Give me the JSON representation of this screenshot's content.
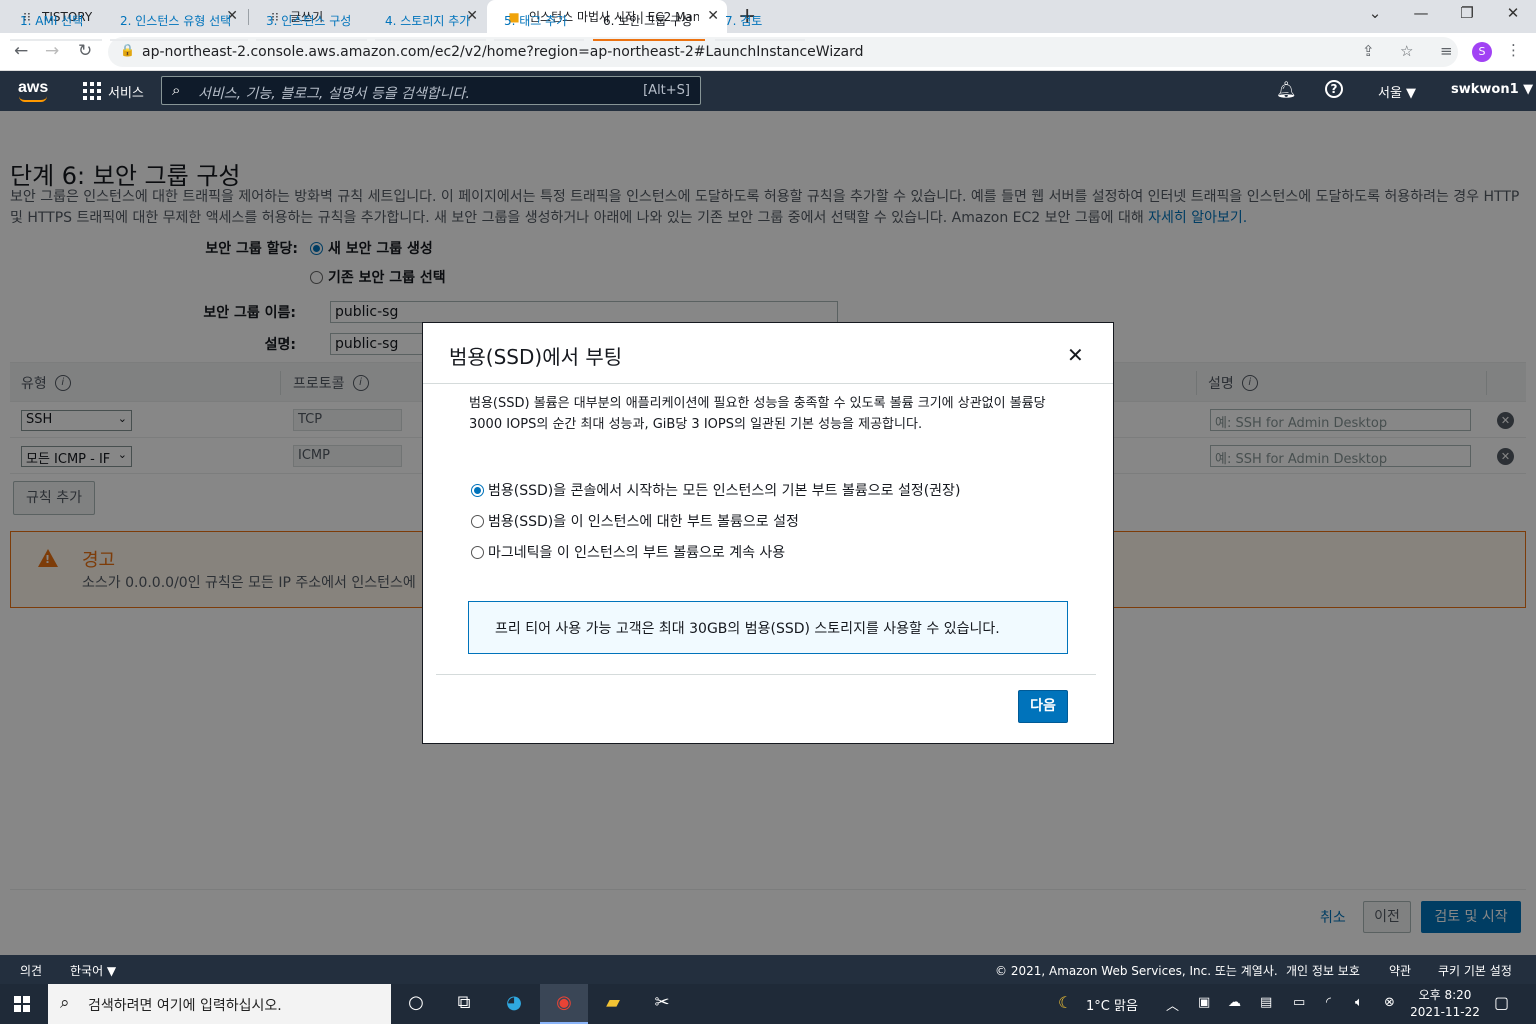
{
  "browser": {
    "tabs": [
      {
        "label": "TISTORY",
        "icon": "tistory-icon"
      },
      {
        "label": "글쓰기",
        "icon": "tistory-icon"
      },
      {
        "label": "인스턴스 마법사 시작 | EC2 Man",
        "icon": "aws-cube-icon"
      }
    ],
    "url": "ap-northeast-2.console.aws.amazon.com/ec2/v2/home?region=ap-northeast-2#LaunchInstanceWizard",
    "profile_initial": "S"
  },
  "aws_header": {
    "logo": "aws",
    "services_label": "서비스",
    "search_placeholder": "서비스, 기능, 블로그, 설명서 등을 검색합니다.",
    "search_shortcut": "[Alt+S]",
    "region": "서울 ▼",
    "user": "swkwon1 ▼"
  },
  "steps": [
    {
      "label": "1. AMI 선택"
    },
    {
      "label": "2. 인스턴스 유형 선택"
    },
    {
      "label": "3. 인스턴스 구성"
    },
    {
      "label": "4. 스토리지 추가"
    },
    {
      "label": "5. 태그 추가"
    },
    {
      "label": "6. 보안 그룹 구성",
      "active": true
    },
    {
      "label": "7. 검토"
    }
  ],
  "page": {
    "title": "단계 6: 보안 그룹 구성",
    "intro": "보안 그룹은 인스턴스에 대한 트래픽을 제어하는 방화벽 규칙 세트입니다. 이 페이지에서는 특정 트래픽을 인스턴스에 도달하도록 허용할 규칙을 추가할 수 있습니다. 예를 들면 웹 서버를 설정하여 인터넷 트래픽을 인스턴스에 도달하도록 허용하려는 경우 HTTP 및 HTTPS 트래픽에 대한 무제한 액세스를 허용하는 규칙을 추가합니다. 새 보안 그룹을 생성하거나 아래에 나와 있는 기존 보안 그룹 중에서 선택할 수 있습니다. Amazon EC2 보안 그룹에 대해 ",
    "intro_link": "자세히 알아보기.",
    "sg_assign_label": "보안 그룹 할당:",
    "sg_new": "새 보안 그룹 생성",
    "sg_existing": "기존 보안 그룹 선택",
    "sg_name_label": "보안 그룹 이름:",
    "sg_name_value": "public-sg",
    "desc_label": "설명:",
    "desc_value": "public-sg"
  },
  "rules_table": {
    "headers": {
      "type": "유형",
      "protocol": "프로토콜",
      "description": "설명"
    },
    "rows": [
      {
        "type": "SSH",
        "protocol": "TCP",
        "desc_placeholder": "예: SSH for Admin Desktop"
      },
      {
        "type": "모든 ICMP - IF",
        "protocol": "ICMP",
        "desc_placeholder": "예: SSH for Admin Desktop"
      }
    ],
    "add_rule": "규칙 추가"
  },
  "warning": {
    "title": "경고",
    "text": "소스가 0.0.0.0/0인 규칙은 모든 IP 주소에서 인스턴스에"
  },
  "actions": {
    "cancel": "취소",
    "previous": "이전",
    "review_launch": "검토 및 시작"
  },
  "modal": {
    "title": "범용(SSD)에서 부팅",
    "description": "범용(SSD) 볼륨은 대부분의 애플리케이션에 필요한 성능을 충족할 수 있도록 볼륨 크기에 상관없이 볼륨당 3000 IOPS의 순간 최대 성능과, GiB당 3 IOPS의 일관된 기본 성능을 제공합니다.",
    "options": [
      {
        "label": "범용(SSD)을 콘솔에서 시작하는 모든 인스턴스의 기본 부트 볼륨으로 설정(권장)",
        "selected": true
      },
      {
        "label": "범용(SSD)을 이 인스턴스에 대한 부트 볼륨으로 설정",
        "selected": false
      },
      {
        "label": "마그네틱을 이 인스턴스의 부트 볼륨으로 계속 사용",
        "selected": false
      }
    ],
    "info": "프리 티어 사용 가능 고객은 최대 30GB의 범용(SSD) 스토리지를 사용할 수 있습니다.",
    "next": "다음"
  },
  "footer": {
    "feedback": "의견",
    "language": "한국어 ▼",
    "copyright": "© 2021, Amazon Web Services, Inc. 또는 계열사.",
    "privacy": "개인 정보 보호",
    "terms": "약관",
    "cookies": "쿠키 기본 설정"
  },
  "taskbar": {
    "search_placeholder": "검색하려면 여기에 입력하십시오.",
    "weather": "1°C 맑음",
    "time": "오후 8:20",
    "date": "2021-11-22"
  }
}
